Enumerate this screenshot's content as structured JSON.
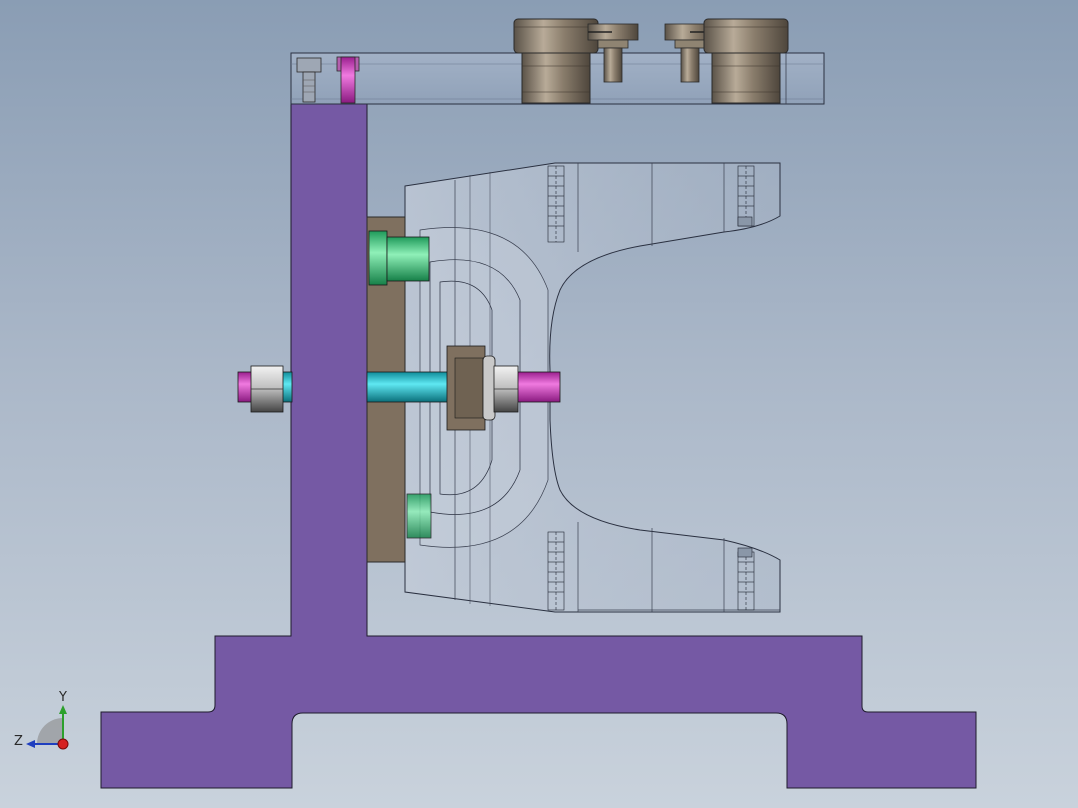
{
  "view": {
    "background_top": "#8a9db4",
    "background_bottom": "#c9d2dc"
  },
  "triad": {
    "y_label": "Y",
    "z_label": "Z",
    "y_color": "#2ca02c",
    "z_color": "#1f3fbf",
    "x_color": "#d62020"
  },
  "parts": {
    "fixture_body_color": "#7559a4",
    "clamp_plate_color": "#87939f",
    "spacer_plate_color": "#7f705f",
    "stud_color": "#1fbfcf",
    "locating_pin_color": "#3fcf8f",
    "stud_end_color": "#d040c0",
    "nut_color": "#d9d9d9",
    "cap_screw_color": "#8c8070"
  }
}
